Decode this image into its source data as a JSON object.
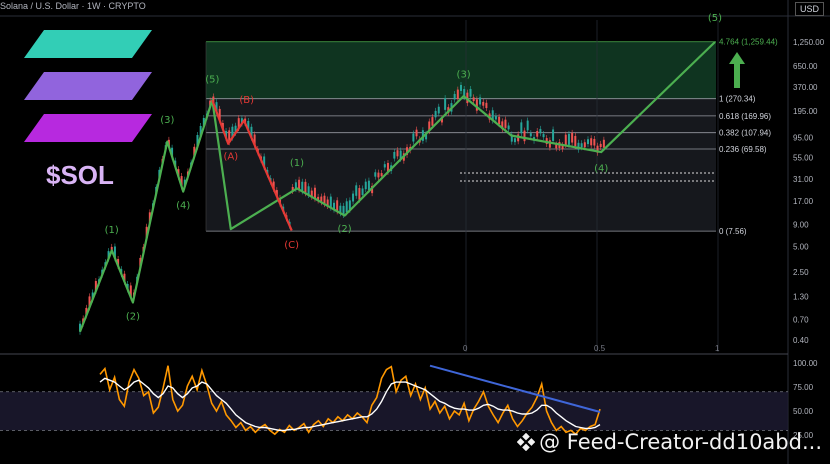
{
  "header": {
    "title": "Solana / U.S. Dollar · 1W · CRYPTO",
    "currency": "USD"
  },
  "logo": {
    "ticker": "$SOL",
    "colors": [
      "#36e0c6",
      "#9d6cf0",
      "#c72cf2"
    ]
  },
  "watermark": {
    "text": "@ Feed-Creator-dd10abd..."
  },
  "chart_data": [
    {
      "type": "line",
      "title": "",
      "y_scale": "log",
      "y_ticks": [
        "1,250.00",
        "650.00",
        "370.00",
        "195.00",
        "95.00",
        "55.00",
        "31.00",
        "17.00",
        "9.00",
        "5.00",
        "2.50",
        "1.30",
        "0.70",
        "0.40"
      ],
      "y_tick_values": [
        1250,
        650,
        370,
        195,
        95,
        55,
        31,
        17,
        9,
        5,
        2.5,
        1.3,
        0.7,
        0.4
      ],
      "x_ticks": [
        "0",
        "0.5",
        "1"
      ],
      "fib_levels": [
        {
          "label": "4.764 (1,259.44)",
          "price": 1259.44
        },
        {
          "label": "1 (270.34)",
          "price": 270.34
        },
        {
          "label": "0.618 (169.96)",
          "price": 169.96
        },
        {
          "label": "0.382 (107.94)",
          "price": 107.94
        },
        {
          "label": "0.236 (69.58)",
          "price": 69.58
        },
        {
          "label": "0 (7.56)",
          "price": 7.56
        }
      ],
      "series": [
        {
          "color": "#4caf50",
          "points": [
            [
              0.0,
              0.5
            ],
            [
              0.12,
              4.5
            ],
            [
              0.2,
              1.1
            ],
            [
              0.33,
              85
            ],
            [
              0.39,
              22
            ],
            [
              0.5,
              260
            ],
            [
              0.57,
              8
            ],
            [
              0.82,
              24
            ],
            [
              1.0,
              11.5
            ],
            [
              1.45,
              290
            ],
            [
              1.63,
              100
            ],
            [
              1.97,
              64
            ],
            [
              2.4,
              1250
            ]
          ]
        },
        {
          "color": "#e53935",
          "points": [
            [
              0.5,
              260
            ],
            [
              0.56,
              80
            ],
            [
              0.62,
              150
            ],
            [
              0.8,
              7.7
            ]
          ]
        }
      ],
      "wave_labels": [
        {
          "text": "(1)",
          "x": 0.12,
          "y": 7.2,
          "color": "#4caf50"
        },
        {
          "text": "(2)",
          "x": 0.2,
          "y": 0.7,
          "color": "#4caf50"
        },
        {
          "text": "(3)",
          "x": 0.33,
          "y": 140,
          "color": "#4caf50"
        },
        {
          "text": "(4)",
          "x": 0.39,
          "y": 14,
          "color": "#4caf50"
        },
        {
          "text": "(5)",
          "x": 0.5,
          "y": 420,
          "color": "#4caf50"
        },
        {
          "text": "(A)",
          "x": 0.57,
          "y": 52,
          "color": "#e53935"
        },
        {
          "text": "(B)",
          "x": 0.63,
          "y": 240,
          "color": "#e53935"
        },
        {
          "text": "(C)",
          "x": 0.8,
          "y": 4.8,
          "color": "#e53935"
        },
        {
          "text": "(1)",
          "x": 0.82,
          "y": 44,
          "color": "#4caf50"
        },
        {
          "text": "(2)",
          "x": 1.0,
          "y": 7.4,
          "color": "#4caf50"
        },
        {
          "text": "(3)",
          "x": 1.45,
          "y": 480,
          "color": "#4caf50"
        },
        {
          "text": "(4)",
          "x": 1.97,
          "y": 38,
          "color": "#4caf50"
        },
        {
          "text": "(5)",
          "x": 2.4,
          "y": 2200,
          "color": "#4caf50"
        }
      ]
    },
    {
      "type": "line",
      "title": "",
      "y_ticks": [
        "100.00",
        "75.00",
        "50.00",
        "25.00"
      ],
      "y_tick_values": [
        100,
        75,
        50,
        25
      ],
      "ylim": [
        20,
        105
      ],
      "bands": [
        70,
        30
      ],
      "series": [
        {
          "color": "#ff9800",
          "values": [
            88,
            94,
            72,
            85,
            62,
            55,
            80,
            93,
            84,
            66,
            70,
            48,
            54,
            74,
            97,
            62,
            50,
            56,
            76,
            86,
            72,
            92,
            77,
            58,
            50,
            60,
            46,
            40,
            33,
            38,
            30,
            34,
            28,
            33,
            36,
            30,
            26,
            31,
            28,
            35,
            30,
            33,
            37,
            28,
            36,
            40,
            34,
            42,
            38,
            44,
            40,
            46,
            42,
            48,
            44,
            38,
            56,
            64,
            84,
            93,
            96,
            70,
            82,
            86,
            66,
            78,
            62,
            74,
            52,
            60,
            48,
            55,
            42,
            50,
            46,
            58,
            40,
            52,
            60,
            70,
            55,
            46,
            38,
            48,
            56,
            42,
            34,
            40,
            48,
            54,
            64,
            78,
            50,
            38,
            30,
            34,
            28,
            30,
            26,
            32,
            30,
            34,
            36,
            52
          ]
        },
        {
          "color": "#ffffff",
          "values": [
            80,
            84,
            82,
            80,
            76,
            72,
            75,
            80,
            82,
            78,
            74,
            68,
            64,
            68,
            76,
            74,
            68,
            64,
            68,
            74,
            76,
            80,
            78,
            72,
            66,
            62,
            58,
            52,
            46,
            42,
            38,
            36,
            34,
            33,
            33,
            32,
            31,
            30,
            30,
            31,
            31,
            32,
            33,
            33,
            34,
            35,
            36,
            37,
            38,
            39,
            40,
            41,
            42,
            43,
            44,
            44,
            47,
            52,
            60,
            70,
            78,
            80,
            80,
            80,
            78,
            76,
            74,
            72,
            68,
            64,
            60,
            58,
            55,
            53,
            52,
            52,
            51,
            51,
            53,
            56,
            57,
            55,
            52,
            51,
            51,
            50,
            48,
            47,
            47,
            48,
            51,
            56,
            56,
            53,
            48,
            44,
            40,
            37,
            34,
            33,
            32,
            32,
            33,
            36
          ]
        }
      ],
      "trendline": {
        "color": "#3f66d8",
        "from": [
          0.66,
          97
        ],
        "to": [
          1.0,
          49
        ]
      }
    }
  ]
}
